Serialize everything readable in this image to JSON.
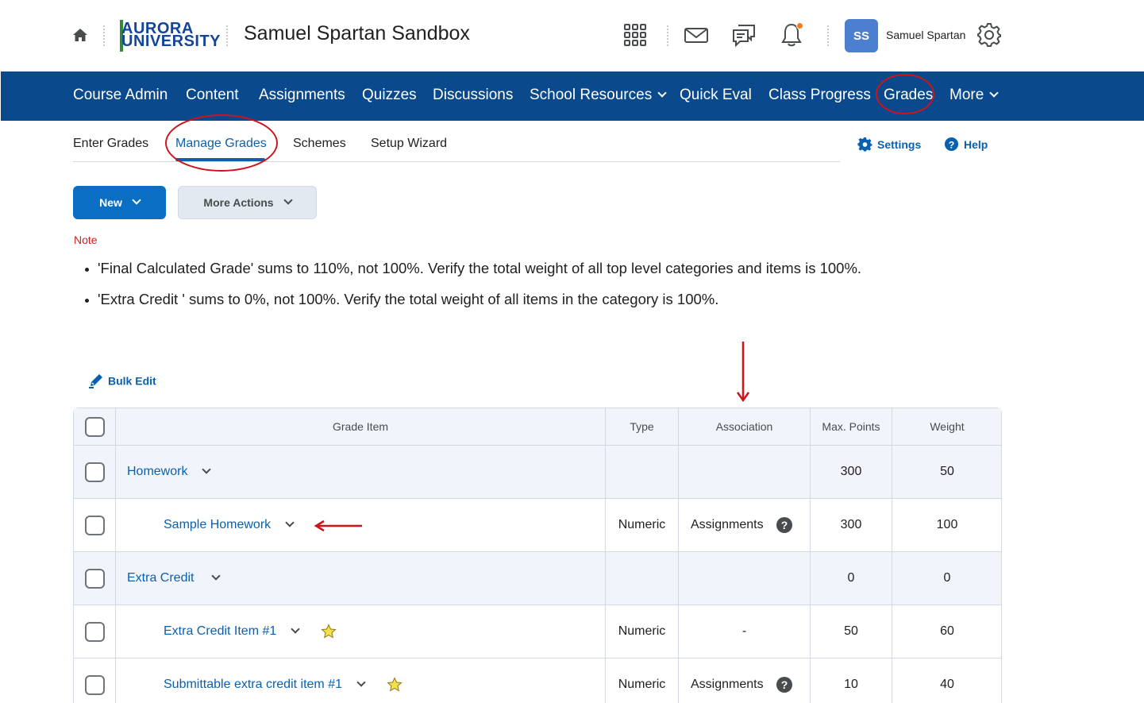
{
  "header": {
    "logo_line1": "AURORA",
    "logo_line2": "UNIVERSITY",
    "course_title": "Samuel Spartan Sandbox",
    "avatar_initials": "SS",
    "user_name": "Samuel Spartan",
    "icons": [
      "home-icon",
      "apps-grid-icon",
      "mail-icon",
      "chat-icon",
      "bell-icon",
      "gear-icon"
    ],
    "notification_dot_color": "#ef7d22"
  },
  "nav": {
    "items": [
      {
        "label": "Course Admin"
      },
      {
        "label": "Content"
      },
      {
        "label": "Assignments"
      },
      {
        "label": "Quizzes"
      },
      {
        "label": "Discussions"
      },
      {
        "label": "School Resources"
      },
      {
        "label": "Quick Eval"
      },
      {
        "label": "Class Progress"
      },
      {
        "label": "Grades"
      },
      {
        "label": "More"
      }
    ],
    "bg_color": "#0a4a8c"
  },
  "tabs": {
    "items": [
      {
        "label": "Enter Grades"
      },
      {
        "label": "Manage Grades",
        "active": true
      },
      {
        "label": "Schemes"
      },
      {
        "label": "Setup Wizard"
      }
    ],
    "settings_label": "Settings",
    "help_label": "Help"
  },
  "toolbar": {
    "new_label": "New",
    "more_actions_label": "More Actions",
    "bulk_edit_label": "Bulk Edit"
  },
  "note": {
    "label": "Note",
    "messages": [
      "'Final Calculated Grade' sums to 110%, not 100%. Verify the total weight of all top level categories and items is 100%.",
      "'Extra Credit ' sums to 0%, not 100%. Verify the total weight of all items in the category is 100%."
    ]
  },
  "table": {
    "headers": {
      "grade_item": "Grade Item",
      "type": "Type",
      "association": "Association",
      "max_points": "Max. Points",
      "weight": "Weight"
    },
    "rows": [
      {
        "name": "Homework",
        "kind": "category",
        "type": "",
        "association": "",
        "max_points": "300",
        "weight": "50"
      },
      {
        "name": "Sample Homework",
        "kind": "item",
        "type": "Numeric",
        "association": "Assignments",
        "max_points": "300",
        "weight": "100"
      },
      {
        "name": "Extra Credit",
        "kind": "category",
        "type": "",
        "association": "",
        "max_points": "0",
        "weight": "0"
      },
      {
        "name": "Extra Credit Item #1",
        "kind": "item",
        "bonus": true,
        "type": "Numeric",
        "association": "-",
        "max_points": "50",
        "weight": "60"
      },
      {
        "name": "Submittable extra credit item #1",
        "kind": "item",
        "bonus": true,
        "type": "Numeric",
        "association": "Assignments",
        "max_points": "10",
        "weight": "40"
      }
    ]
  },
  "annotation_color": "#d0121b"
}
